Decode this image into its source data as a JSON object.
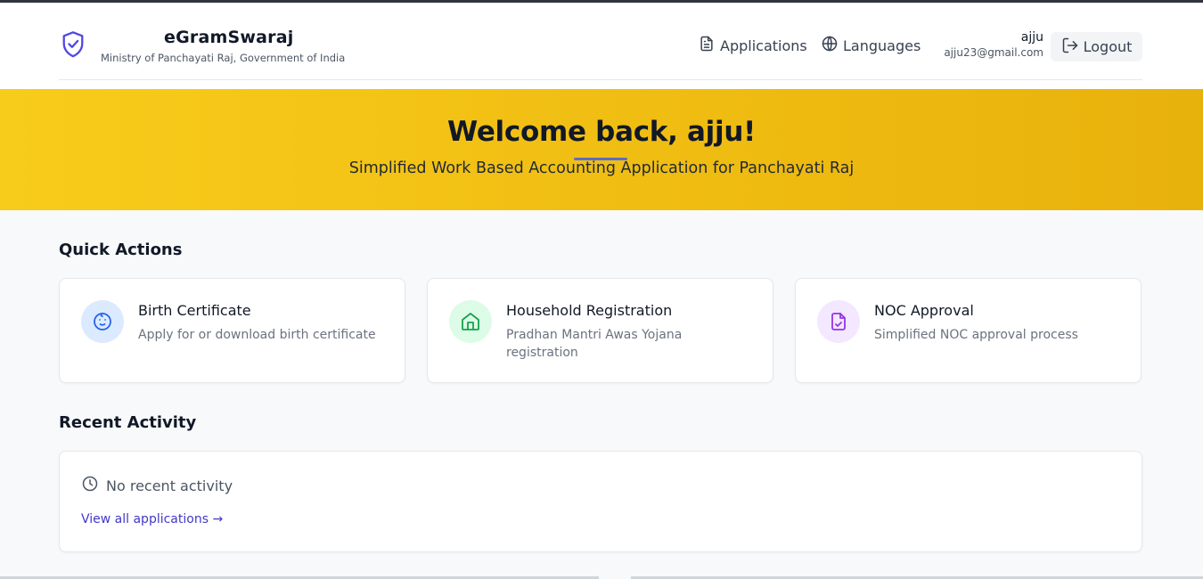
{
  "brand": {
    "title": "eGramSwaraj",
    "subtitle": "Ministry of Panchayati Raj, Government of India",
    "icon": "shield-check-icon",
    "accent": "#4f46e5"
  },
  "nav": {
    "applications": "Applications",
    "languages": "Languages"
  },
  "user": {
    "name": "ajju",
    "email": "ajju23@gmail.com",
    "logout": "Logout"
  },
  "hero": {
    "title": "Welcome back, ajju!",
    "subtitle": "Simplified Work Based Accounting Application for Panchayati Raj",
    "background": "#f5c518"
  },
  "quick_actions": {
    "title": "Quick Actions",
    "items": [
      {
        "title": "Birth Certificate",
        "desc": "Apply for or download birth certificate",
        "icon": "baby-icon",
        "color": "#2563eb"
      },
      {
        "title": "Household Registration",
        "desc": "Pradhan Mantri Awas Yojana registration",
        "icon": "home-icon",
        "color": "#16a34a"
      },
      {
        "title": "NOC Approval",
        "desc": "Simplified NOC approval process",
        "icon": "file-check-icon",
        "color": "#9333ea"
      }
    ]
  },
  "recent_activity": {
    "title": "Recent Activity",
    "empty": "No recent activity",
    "view_all": "View all applications →"
  }
}
